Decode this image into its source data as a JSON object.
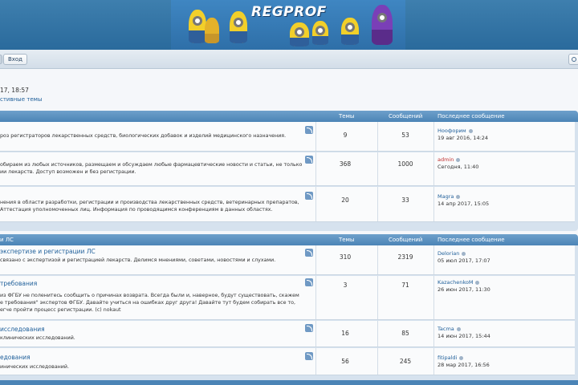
{
  "header": {
    "logo_text": "REGPROF"
  },
  "navbar": {
    "login_label": "Вход"
  },
  "info": {
    "datetime": "17, 18:57",
    "active_topics": "стивные темы"
  },
  "sections": [
    {
      "name": "",
      "col_topics": "Темы",
      "col_posts": "Сообщений",
      "col_last": "Последнее сообщение",
      "forums": [
        {
          "title": "",
          "desc": [
            "роз регистраторов лекарственных средств, биологических добавок и изделий медицинского назначения."
          ],
          "topics": "9",
          "posts": "53",
          "last_user": "Ноофорим",
          "last_user_red": false,
          "last_date": "19 авг 2016, 14:24"
        },
        {
          "title": "",
          "desc": [
            "обираем из любых источников, размещаем и обсуждаем любые фармацевтические новости и статьи, не только",
            "ии лекарств. Доступ возможен и без регистрации."
          ],
          "topics": "368",
          "posts": "1000",
          "last_user": "admin",
          "last_user_red": true,
          "last_date": "Сегодня, 11:40"
        },
        {
          "title": "",
          "desc": [
            "нения в области разработки, регистрации и производства лекарственных средств, ветеринарных препаратов,",
            "Аттестация уполномоченных лиц. Информация по проводящимся конференциям в данных областях."
          ],
          "topics": "20",
          "posts": "33",
          "last_user": "Magra",
          "last_user_red": false,
          "last_date": "14 апр 2017, 15:05"
        }
      ]
    },
    {
      "name": "и ЛС",
      "col_topics": "Темы",
      "col_posts": "Сообщений",
      "col_last": "Последнее сообщение",
      "forums": [
        {
          "title": "экспертизе и регистрации ЛС",
          "desc": [
            "связано с экспертизой и регистрацией лекарств. Делимся мнениями, советами, новостями и слухами."
          ],
          "topics": "310",
          "posts": "2319",
          "last_user": "Delorian",
          "last_user_red": false,
          "last_date": "05 июл 2017, 17:07"
        },
        {
          "title": "требования",
          "desc": [
            "из ФГБУ не поленитесь сообщить о причинах возврата. Всегда были и, наверное, будут существовать, скажем",
            "е требования\" экспертов ФГБУ. Давайте учиться на ошибках друг друга! Давайте тут будем собирать все то,",
            "егче пройти процесс регистрации. (с) nokaut"
          ],
          "topics": "3",
          "posts": "71",
          "last_user": "KazachenkoM",
          "last_user_red": false,
          "last_date": "26 июн 2017, 11:30"
        },
        {
          "title": "исследования",
          "desc": [
            "клинических исследований."
          ],
          "topics": "16",
          "posts": "85",
          "last_user": "Tacma",
          "last_user_red": false,
          "last_date": "14 июн 2017, 15:44"
        },
        {
          "title": "едования",
          "desc": [
            "инических исследований."
          ],
          "topics": "56",
          "posts": "245",
          "last_user": "fitipaldi",
          "last_user_red": false,
          "last_date": "28 мар 2017, 16:56"
        }
      ]
    }
  ]
}
